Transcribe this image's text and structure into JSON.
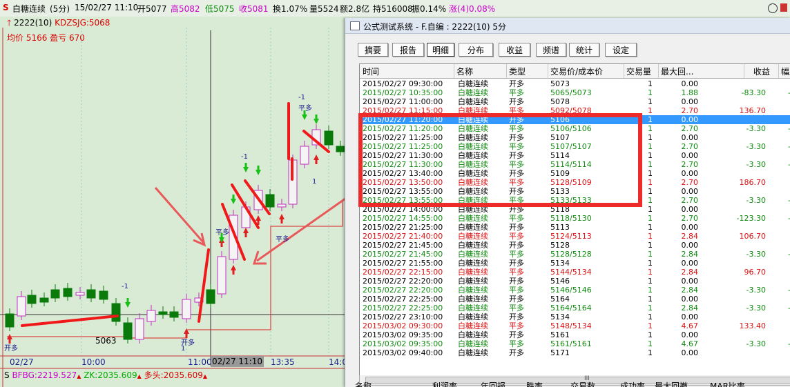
{
  "chart_header": {
    "symbol_icon": "S",
    "name": "白糖连续",
    "period": "(5分)",
    "datetime": "15/02/27 11:10",
    "open": "开5077",
    "high": "高5082",
    "low": "低5075",
    "close": "收5081",
    "turnover": "换1.07%",
    "volume": "量5524",
    "amount": "额2.8亿",
    "position": "持516008",
    "amplitude": "振0.14%",
    "change": "涨(4)0.08%",
    "clock_icon": "clock-icon"
  },
  "legend": {
    "line1_prefix": "2222(10)",
    "line1_name": "KDZSJG:5068",
    "line2": "均价 5166 盈亏 670"
  },
  "chart_labels": {
    "low_price": "5063",
    "signal_open_long": "开多",
    "signal_close_long": "平多",
    "minus_one": "-1",
    "one": "1"
  },
  "x_axis": [
    "02/27",
    "10:00",
    "11:00",
    "02/27 11:10",
    "13:35",
    "14:0"
  ],
  "bottom_indicator": {
    "icon": "S",
    "bfbg": "BFBG:2219.527",
    "zk": "ZK:2035.609",
    "duotou": "多头:2035.609"
  },
  "window": {
    "title": "公式测试系统 - F.自编 : 2222(10) 5分",
    "tabs": [
      "摘要",
      "报告",
      "明细",
      "分布",
      "收益",
      "频谱",
      "统计",
      "设定"
    ],
    "active_tab": "明细",
    "columns": [
      "时间",
      "名称",
      "类型",
      "交易价/成本价",
      "交易量",
      "最大回...",
      "收益",
      "幅度"
    ],
    "rows": [
      {
        "time": "2015/02/27  09:30:00",
        "name": "白糖连续",
        "type": "开多",
        "price": "5073",
        "qty": "1",
        "dd": "0.00",
        "profit": "",
        "pct": "",
        "color": "k"
      },
      {
        "time": "2015/02/27  10:35:00",
        "name": "白糖连续",
        "type": "平多",
        "price": "5065/5073",
        "qty": "1",
        "dd": "1.88",
        "profit": "-83.30",
        "pct": "-",
        "color": "g"
      },
      {
        "time": "2015/02/27  11:00:00",
        "name": "白糖连续",
        "type": "开多",
        "price": "5078",
        "qty": "1",
        "dd": "0.00",
        "profit": "",
        "pct": "",
        "color": "k"
      },
      {
        "time": "2015/02/27  11:15:00",
        "name": "白糖连续",
        "type": "平多",
        "price": "5092/5078",
        "qty": "1",
        "dd": "2.70",
        "profit": "136.70",
        "pct": "",
        "color": "r"
      },
      {
        "time": "2015/02/27  11:20:00",
        "name": "白糖连续",
        "type": "开多",
        "price": "5106",
        "qty": "1",
        "dd": "0.00",
        "profit": "",
        "pct": "",
        "color": "sel"
      },
      {
        "time": "2015/02/27  11:20:00",
        "name": "白糖连续",
        "type": "平多",
        "price": "5106/5106",
        "qty": "1",
        "dd": "2.70",
        "profit": "-3.30",
        "pct": "-",
        "color": "g"
      },
      {
        "time": "2015/02/27  11:25:00",
        "name": "白糖连续",
        "type": "开多",
        "price": "5107",
        "qty": "1",
        "dd": "0.00",
        "profit": "",
        "pct": "",
        "color": "k"
      },
      {
        "time": "2015/02/27  11:25:00",
        "name": "白糖连续",
        "type": "平多",
        "price": "5107/5107",
        "qty": "1",
        "dd": "2.70",
        "profit": "-3.30",
        "pct": "-",
        "color": "g"
      },
      {
        "time": "2015/02/27  11:30:00",
        "name": "白糖连续",
        "type": "开多",
        "price": "5114",
        "qty": "1",
        "dd": "0.00",
        "profit": "",
        "pct": "",
        "color": "k"
      },
      {
        "time": "2015/02/27  11:30:00",
        "name": "白糖连续",
        "type": "平多",
        "price": "5114/5114",
        "qty": "1",
        "dd": "2.70",
        "profit": "-3.30",
        "pct": "-",
        "color": "g"
      },
      {
        "time": "2015/02/27  13:40:00",
        "name": "白糖连续",
        "type": "开多",
        "price": "5109",
        "qty": "1",
        "dd": "0.00",
        "profit": "",
        "pct": "",
        "color": "k"
      },
      {
        "time": "2015/02/27  13:50:00",
        "name": "白糖连续",
        "type": "平多",
        "price": "5128/5109",
        "qty": "1",
        "dd": "2.70",
        "profit": "186.70",
        "pct": "",
        "color": "r"
      },
      {
        "time": "2015/02/27  13:55:00",
        "name": "白糖连续",
        "type": "开多",
        "price": "5133",
        "qty": "1",
        "dd": "0.00",
        "profit": "",
        "pct": "",
        "color": "k"
      },
      {
        "time": "2015/02/27  13:55:00",
        "name": "白糖连续",
        "type": "平多",
        "price": "5133/5133",
        "qty": "1",
        "dd": "2.70",
        "profit": "-3.30",
        "pct": "-",
        "color": "g"
      },
      {
        "time": "2015/02/27  14:00:00",
        "name": "白糖连续",
        "type": "开多",
        "price": "5118",
        "qty": "1",
        "dd": "0.00",
        "profit": "",
        "pct": "",
        "color": "k"
      },
      {
        "time": "2015/02/27  14:55:00",
        "name": "白糖连续",
        "type": "平多",
        "price": "5118/5130",
        "qty": "1",
        "dd": "2.70",
        "profit": "-123.30",
        "pct": "-",
        "color": "g"
      },
      {
        "time": "2015/02/27  21:25:00",
        "name": "白糖连续",
        "type": "开多",
        "price": "5113",
        "qty": "1",
        "dd": "0.00",
        "profit": "",
        "pct": "",
        "color": "k"
      },
      {
        "time": "2015/02/27  21:40:00",
        "name": "白糖连续",
        "type": "平多",
        "price": "5124/5113",
        "qty": "1",
        "dd": "2.84",
        "profit": "106.70",
        "pct": "",
        "color": "r"
      },
      {
        "time": "2015/02/27  21:45:00",
        "name": "白糖连续",
        "type": "开多",
        "price": "5128",
        "qty": "1",
        "dd": "0.00",
        "profit": "",
        "pct": "",
        "color": "k"
      },
      {
        "time": "2015/02/27  21:45:00",
        "name": "白糖连续",
        "type": "平多",
        "price": "5128/5128",
        "qty": "1",
        "dd": "2.84",
        "profit": "-3.30",
        "pct": "-",
        "color": "g"
      },
      {
        "time": "2015/02/27  21:55:00",
        "name": "白糖连续",
        "type": "开多",
        "price": "5134",
        "qty": "1",
        "dd": "0.00",
        "profit": "",
        "pct": "",
        "color": "k"
      },
      {
        "time": "2015/02/27  22:15:00",
        "name": "白糖连续",
        "type": "平多",
        "price": "5144/5134",
        "qty": "1",
        "dd": "2.84",
        "profit": "96.70",
        "pct": "",
        "color": "r"
      },
      {
        "time": "2015/02/27  22:20:00",
        "name": "白糖连续",
        "type": "开多",
        "price": "5146",
        "qty": "1",
        "dd": "0.00",
        "profit": "",
        "pct": "",
        "color": "k"
      },
      {
        "time": "2015/02/27  22:20:00",
        "name": "白糖连续",
        "type": "平多",
        "price": "5146/5146",
        "qty": "1",
        "dd": "2.84",
        "profit": "-3.30",
        "pct": "-",
        "color": "g"
      },
      {
        "time": "2015/02/27  22:25:00",
        "name": "白糖连续",
        "type": "开多",
        "price": "5164",
        "qty": "1",
        "dd": "0.00",
        "profit": "",
        "pct": "",
        "color": "k"
      },
      {
        "time": "2015/02/27  22:25:00",
        "name": "白糖连续",
        "type": "平多",
        "price": "5164/5164",
        "qty": "1",
        "dd": "2.84",
        "profit": "-3.30",
        "pct": "-",
        "color": "g"
      },
      {
        "time": "2015/02/27  23:10:00",
        "name": "白糖连续",
        "type": "开多",
        "price": "5134",
        "qty": "1",
        "dd": "0.00",
        "profit": "",
        "pct": "",
        "color": "k"
      },
      {
        "time": "2015/03/02  09:30:00",
        "name": "白糖连续",
        "type": "平多",
        "price": "5148/5134",
        "qty": "1",
        "dd": "4.67",
        "profit": "133.40",
        "pct": "",
        "color": "r"
      },
      {
        "time": "2015/03/02  09:35:00",
        "name": "白糖连续",
        "type": "开多",
        "price": "5161",
        "qty": "1",
        "dd": "0.00",
        "profit": "",
        "pct": "",
        "color": "k"
      },
      {
        "time": "2015/03/02  09:35:00",
        "name": "白糖连续",
        "type": "平多",
        "price": "5161/5161",
        "qty": "1",
        "dd": "4.67",
        "profit": "-3.30",
        "pct": "-",
        "color": "g"
      },
      {
        "time": "2015/03/02  09:40:00",
        "name": "白糖连续",
        "type": "开多",
        "price": "5171",
        "qty": "1",
        "dd": "0.00",
        "profit": "",
        "pct": "",
        "color": "k"
      }
    ],
    "scroll_grip": "III",
    "bottom_columns": [
      "名称",
      "利润率",
      "年回报",
      "胜率",
      "交易数",
      "成功率",
      "最大回撤",
      "MAR比率"
    ]
  },
  "colors": {
    "chart_bg": "#d9ead5",
    "up": "#e8232b",
    "down": "#0a7a0a",
    "axis_text": "#1b1b8f",
    "highlight": "#ee2b2b"
  }
}
